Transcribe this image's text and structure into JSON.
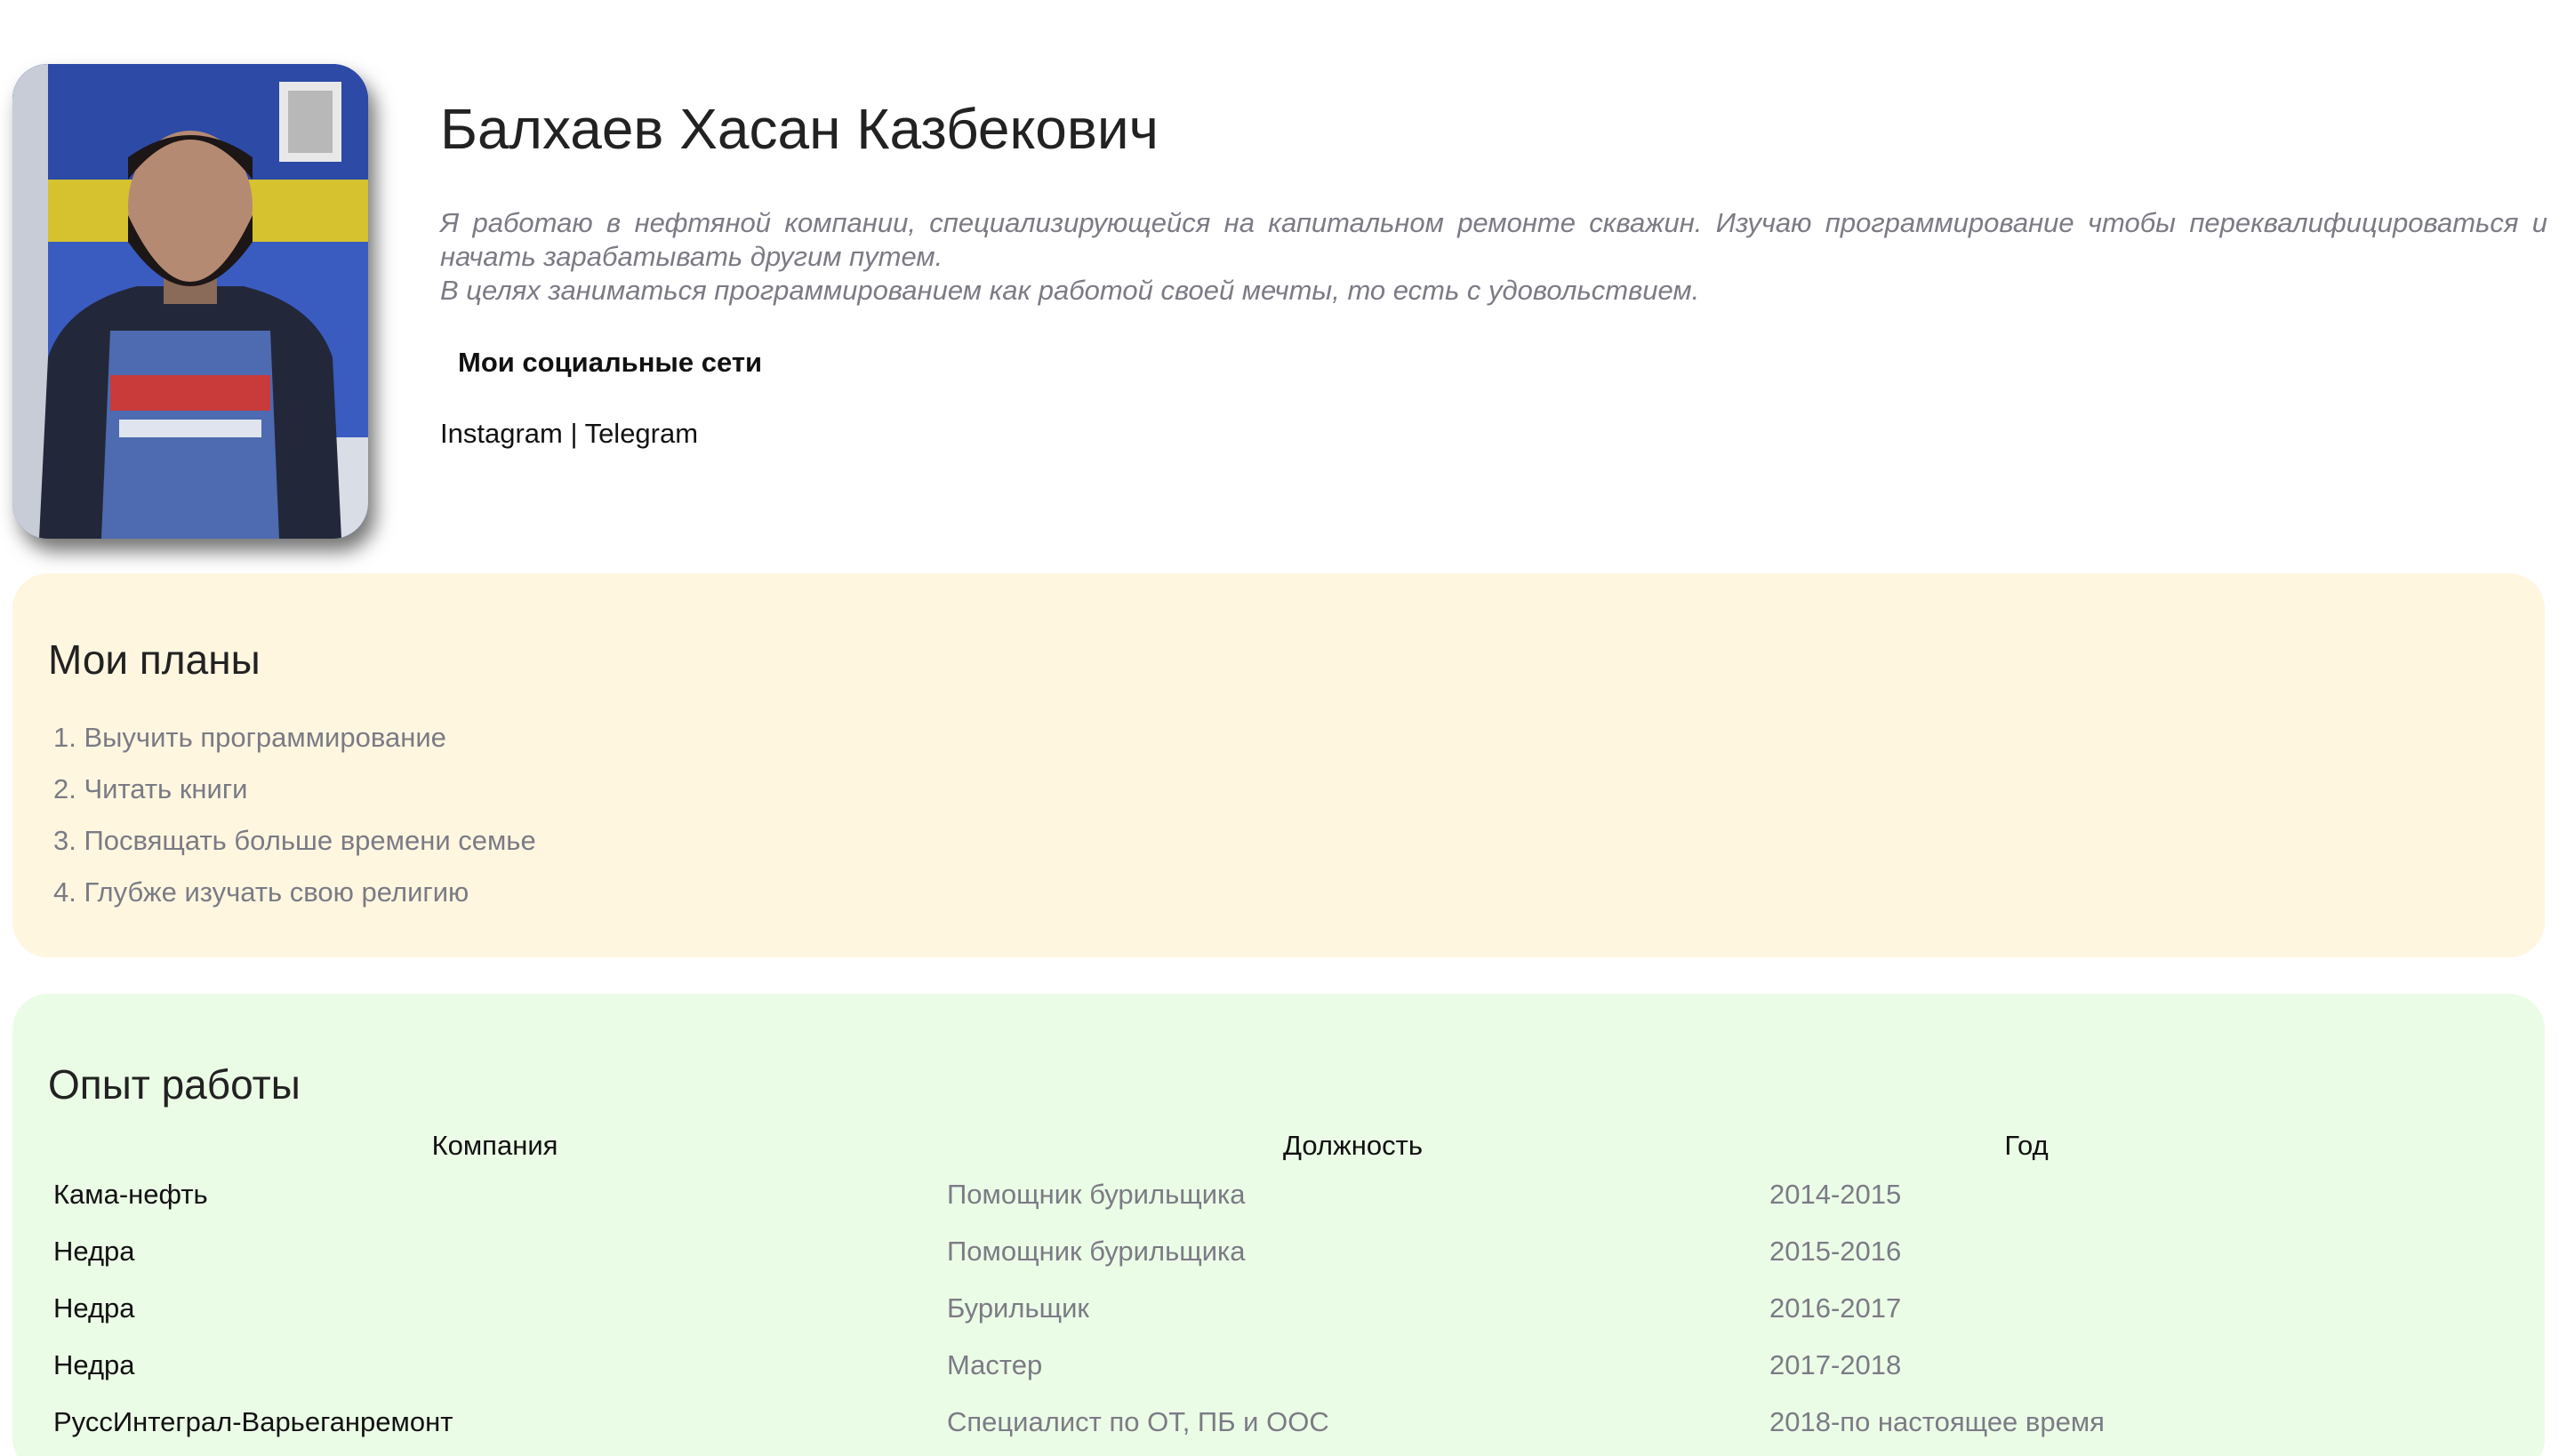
{
  "profile": {
    "name": "Балхаев Хасан Казбекович",
    "about_line1": "Я работаю в нефтяной компании, специализирующейся на капитальном ремонте скважин. Изучаю программирование чтобы переквалифицироваться и начать зарабатывать другим путем.",
    "about_line2": "В целях заниматься программированием как работой своей мечты, то есть с удовольствием.",
    "photo_icon": "profile-photo"
  },
  "social": {
    "title": "Мои социальные сети",
    "instagram": "Instagram",
    "separator": " | ",
    "telegram": "Telegram"
  },
  "plans": {
    "title": "Мои планы",
    "items": [
      "1. Выучить программирование",
      "2. Читать книги",
      "3. Посвящать больше времени семье",
      "4. Глубже изучать свою религию"
    ]
  },
  "experience": {
    "title": "Опыт работы",
    "headers": [
      "Компания",
      "Должность",
      "Год"
    ],
    "rows": [
      [
        "Кама-нефть",
        "Помощник бурильщика",
        "2014-2015"
      ],
      [
        "Недра",
        "Помощник бурильщика",
        "2015-2016"
      ],
      [
        "Недра",
        "Бурильщик",
        "2016-2017"
      ],
      [
        "Недра",
        "Мастер",
        "2017-2018"
      ],
      [
        "РуссИнтеграл-Варьеганремонт",
        "Специалист по ОТ, ПБ и ООС",
        "2018-по настоящее время"
      ]
    ]
  },
  "colors": {
    "plans_bg": "#fff6e0",
    "experience_bg": "#ebfce6",
    "muted_text": "#7b7b85"
  }
}
